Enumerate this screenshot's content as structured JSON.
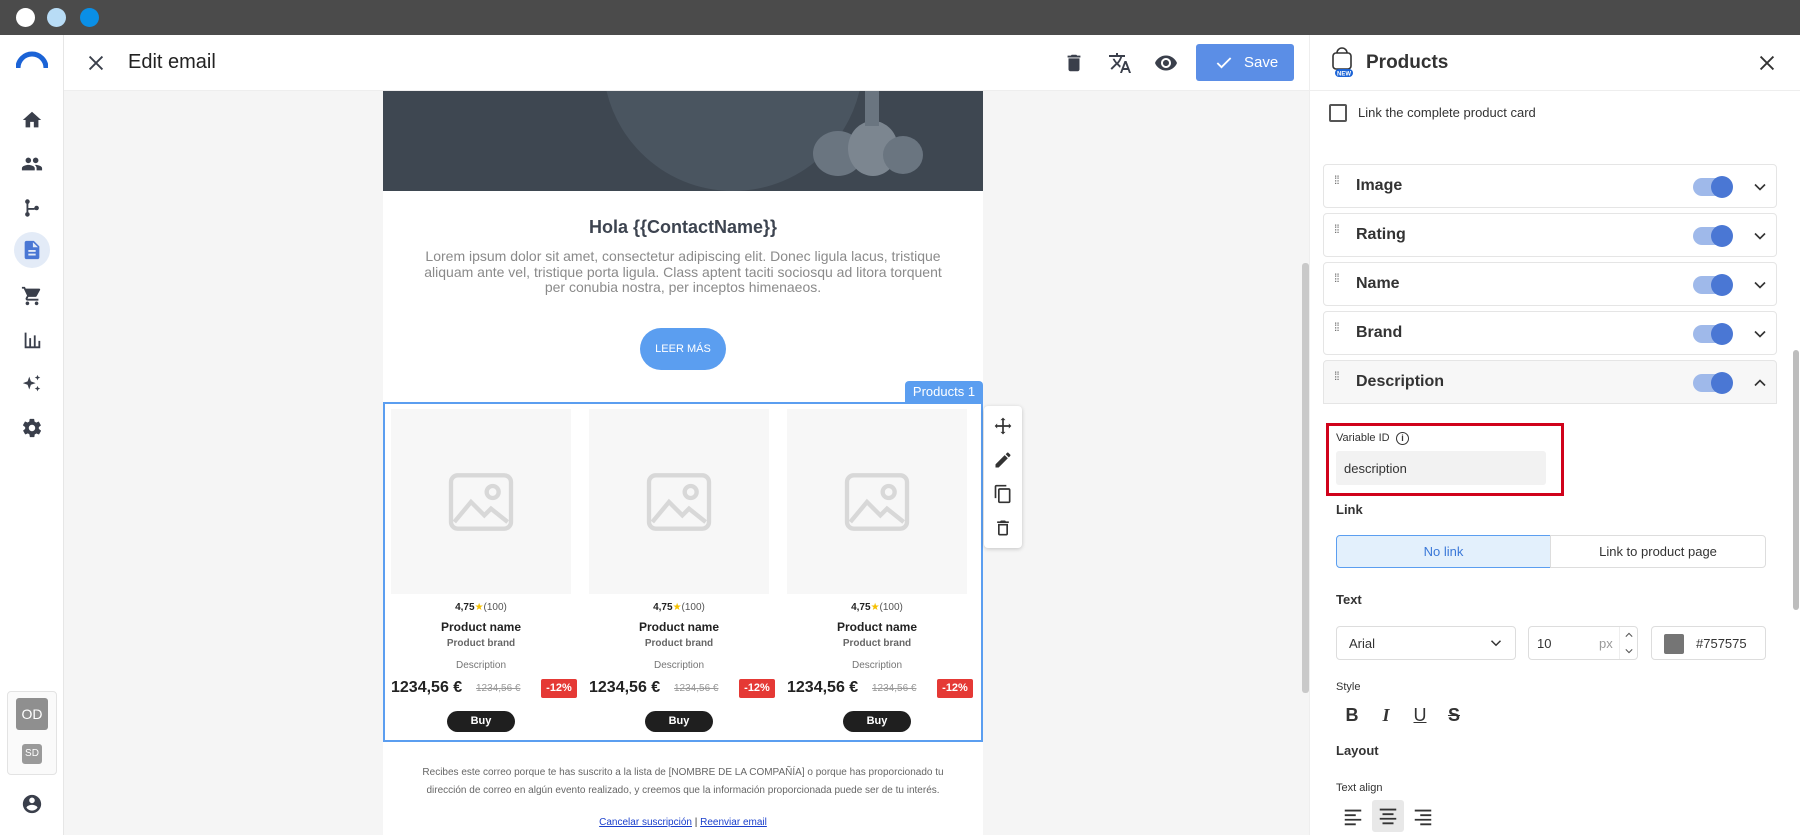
{
  "window": {
    "dot_colors": [
      "#ffffff",
      "#b8dcf6",
      "#0a8fe6"
    ]
  },
  "topbar": {
    "title": "Edit email",
    "save_label": "Save"
  },
  "email": {
    "greeting": "Hola {{ContactName}}",
    "body": "Lorem ipsum dolor sit amet, consectetur adipiscing elit. Donec ligula lacus, tristique aliquam ante vel, tristique porta ligula. Class aptent taciti sociosqu ad litora torquent per conubia nostra, per inceptos himenaeos.",
    "cta": "LEER MÁS",
    "block_tag": "Products 1",
    "products": [
      {
        "rating": "4,75",
        "reviews": "(100)",
        "name": "Product name",
        "brand": "Product brand",
        "description": "Description",
        "price": "1234,56 €",
        "old_price": "1234,56 €",
        "discount": "-12%",
        "buy": "Buy"
      },
      {
        "rating": "4,75",
        "reviews": "(100)",
        "name": "Product name",
        "brand": "Product brand",
        "description": "Description",
        "price": "1234,56 €",
        "old_price": "1234,56 €",
        "discount": "-12%",
        "buy": "Buy"
      },
      {
        "rating": "4,75",
        "reviews": "(100)",
        "name": "Product name",
        "brand": "Product brand",
        "description": "Description",
        "price": "1234,56 €",
        "old_price": "1234,56 €",
        "discount": "-12%",
        "buy": "Buy"
      }
    ],
    "footer_text": "Recibes este correo porque te has suscrito a la lista de [NOMBRE DE LA COMPAÑÍA] o porque has proporcionado tu dirección de correo en algún evento realizado, y creemos que la información proporcionada puede ser de tu interés.",
    "unsubscribe": "Cancelar suscripción",
    "separator": "|",
    "resend": "Reenviar email"
  },
  "sidebar": {
    "avatar_primary": "OD",
    "avatar_secondary": "SD",
    "icons": [
      "home-icon",
      "contacts-icon",
      "flows-icon",
      "email-icon",
      "cart-icon",
      "reports-icon",
      "ai-sparkle-icon",
      "settings-icon",
      "user-account-icon"
    ]
  },
  "panel": {
    "title": "Products",
    "badge": "NEW",
    "link_card_label": "Link the complete product card",
    "sections": [
      {
        "label": "Image",
        "enabled": true,
        "expanded": false
      },
      {
        "label": "Rating",
        "enabled": true,
        "expanded": false
      },
      {
        "label": "Name",
        "enabled": true,
        "expanded": false
      },
      {
        "label": "Brand",
        "enabled": true,
        "expanded": false
      },
      {
        "label": "Description",
        "enabled": true,
        "expanded": true
      }
    ],
    "variable_id_label": "Variable ID",
    "variable_id_value": "description",
    "link_label": "Link",
    "link_options": [
      "No link",
      "Link to product page"
    ],
    "link_selected": "No link",
    "text_label": "Text",
    "font": "Arial",
    "font_size": "10",
    "font_unit": "px",
    "color_hex": "#757575",
    "style_label": "Style",
    "layout_label": "Layout",
    "text_align_label": "Text align",
    "text_align_selected": "center"
  },
  "colors": {
    "accent": "#4a77d4",
    "save_bg": "#5b8ee6",
    "discount": "#e53935",
    "highlight": "#d0021b",
    "selected_bg": "#e3f0fc"
  }
}
